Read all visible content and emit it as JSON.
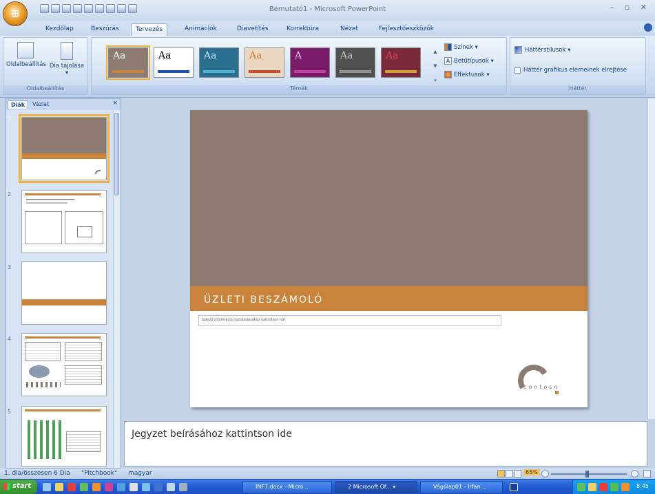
{
  "window": {
    "title": "Bemutató1 - Microsoft PowerPoint",
    "controls": "– ▫ ✕"
  },
  "office_button": {
    "label": "⊞"
  },
  "ribbon_tabs": [
    {
      "label": "Kezdőlap"
    },
    {
      "label": "Beszúrás"
    },
    {
      "label": "Tervezés"
    },
    {
      "label": "Animációk"
    },
    {
      "label": "Diavetítés"
    },
    {
      "label": "Korrektúra"
    },
    {
      "label": "Nézet"
    },
    {
      "label": "Fejlesztőeszközök"
    }
  ],
  "active_tab": "Tervezés",
  "ribbon": {
    "page_setup_group": {
      "label": "Oldalbeállítás",
      "page_setup_btn": "Oldalbeállítás",
      "slide_orientation_btn": "Dia tájolása ▾"
    },
    "themes_group": {
      "label": "Témák",
      "themes": [
        {
          "text": "Aa",
          "bg": "#8c7b70",
          "fg": "#ffffff",
          "bar": "#c9833a"
        },
        {
          "text": "Aa",
          "bg": "#ffffff",
          "fg": "#000000",
          "bar": "#1f4fa8"
        },
        {
          "text": "Aa",
          "bg": "#2a6f8f",
          "fg": "#bfe8ff",
          "bar": "#4fb0d0"
        },
        {
          "text": "Aa",
          "bg": "#e9d7c2",
          "fg": "#d07a30",
          "bar": "#c05030"
        },
        {
          "text": "A",
          "bg": "#7a1c6a",
          "fg": "#f0c0f0",
          "bar": "#c040a0"
        },
        {
          "text": "Aa",
          "bg": "#505050",
          "fg": "#c8c8c8",
          "bar": "#909090"
        },
        {
          "text": "Aa",
          "bg": "#7a2a3a",
          "fg": "#e04060",
          "bar": "#d0a030"
        }
      ],
      "colors_btn": "Színek ▾",
      "fonts_btn": "Betűtípusok ▾",
      "effects_btn": "Effektusok ▾"
    },
    "background_group": {
      "label": "Háttér",
      "bg_styles_btn": "Háttérstílusok ▾",
      "hide_bg_graphics": "Háttér grafikus elemeinek elrejtése"
    }
  },
  "slides_pane": {
    "tabs": [
      {
        "label": "Diák"
      },
      {
        "label": "Vázlat"
      }
    ],
    "close": "×",
    "thumbnails": [
      {
        "num": "1"
      },
      {
        "num": "2"
      },
      {
        "num": "3"
      },
      {
        "num": "4"
      },
      {
        "num": "5"
      }
    ]
  },
  "slide": {
    "title": "ÜZLETI BESZÁMOLÓ",
    "subtitle_placeholder": "Szerző információ hozzáadásához kattintson ide",
    "logo_text": "contoso"
  },
  "notes": {
    "placeholder": "Jegyzet beírásához kattintson ide"
  },
  "status_bar": {
    "slide_info": "1. dia/összesen 6 Dia",
    "theme_name": "\"Pitchbook\"",
    "language": "magyar",
    "zoom": "65%"
  },
  "taskbar": {
    "start": "start",
    "buttons": [
      {
        "label": "INF7.docx - Micro..."
      },
      {
        "label": "2 Microsoft Of... ▾"
      },
      {
        "label": "Vágólap01 - Irfan..."
      }
    ],
    "clock": "8:45"
  }
}
